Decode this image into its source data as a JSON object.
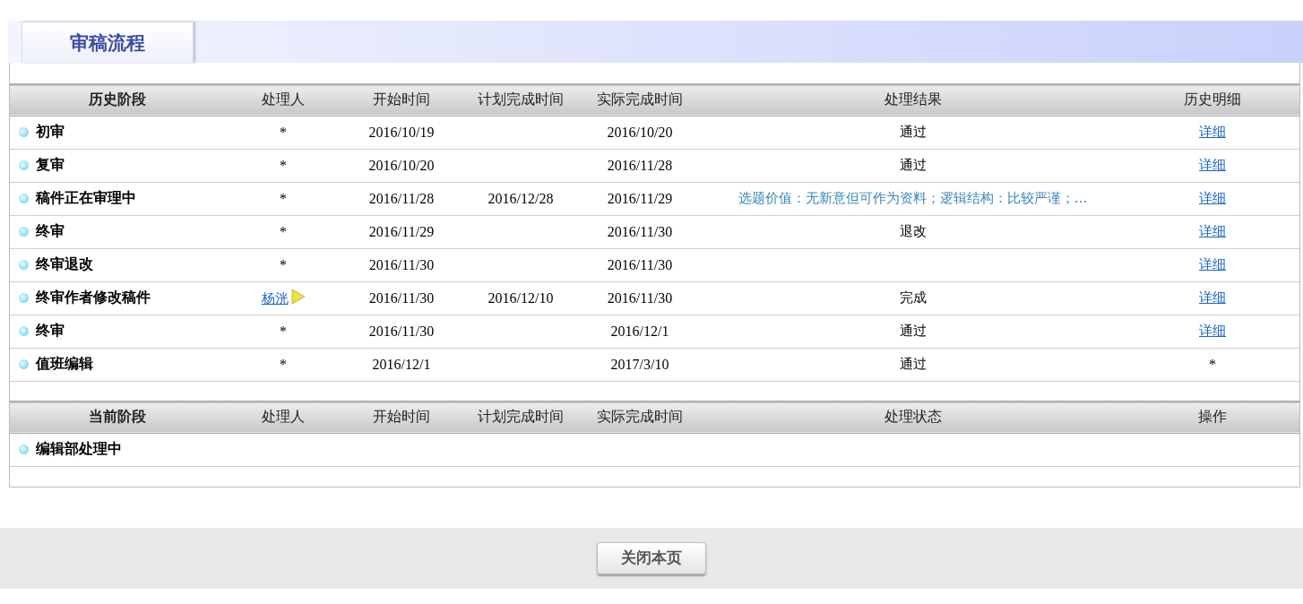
{
  "title_tab": "审稿流程",
  "history": {
    "columns": [
      "历史阶段",
      "处理人",
      "开始时间",
      "计划完成时间",
      "实际完成时间",
      "处理结果",
      "历史明细"
    ],
    "rows": [
      {
        "stage": "初审",
        "handler": {
          "kind": "text",
          "text": "*"
        },
        "start": "2016/10/19",
        "actual": "2016/10/20",
        "result": {
          "kind": "text",
          "text": "通过"
        },
        "detail": {
          "kind": "link",
          "text": "详细"
        }
      },
      {
        "stage": "复审",
        "handler": {
          "kind": "text",
          "text": "*"
        },
        "start": "2016/10/20",
        "actual": "2016/11/28",
        "result": {
          "kind": "text",
          "text": "通过"
        },
        "detail": {
          "kind": "link",
          "text": "详细"
        }
      },
      {
        "stage": "稿件正在审理中",
        "handler": {
          "kind": "text",
          "text": "*"
        },
        "start": "2016/11/28",
        "planned": "2016/12/28",
        "actual": "2016/11/29",
        "result": {
          "kind": "summary",
          "text": "选题价值：无新意但可作为资料；逻辑结构：比较严谨；..."
        },
        "detail": {
          "kind": "link",
          "text": "详细"
        }
      },
      {
        "stage": "终审",
        "handler": {
          "kind": "text",
          "text": "*"
        },
        "start": "2016/11/29",
        "actual": "2016/11/30",
        "result": {
          "kind": "text",
          "text": "退改"
        },
        "detail": {
          "kind": "link",
          "text": "详细"
        }
      },
      {
        "stage": "终审退改",
        "handler": {
          "kind": "text",
          "text": "*"
        },
        "start": "2016/11/30",
        "actual": "2016/11/30",
        "detail": {
          "kind": "link",
          "text": "详细"
        }
      },
      {
        "stage": "终审作者修改稿件",
        "handler": {
          "kind": "link",
          "text": "杨洸"
        },
        "start": "2016/11/30",
        "planned": "2016/12/10",
        "actual": "2016/11/30",
        "result": {
          "kind": "text",
          "text": "完成"
        },
        "detail": {
          "kind": "link",
          "text": "详细"
        }
      },
      {
        "stage": "终审",
        "handler": {
          "kind": "text",
          "text": "*"
        },
        "start": "2016/11/30",
        "actual": "2016/12/1",
        "result": {
          "kind": "text",
          "text": "通过"
        },
        "detail": {
          "kind": "link",
          "text": "详细"
        }
      },
      {
        "stage": "值班编辑",
        "handler": {
          "kind": "text",
          "text": "*"
        },
        "start": "2016/12/1",
        "actual": "2017/3/10",
        "result": {
          "kind": "text",
          "text": "通过"
        },
        "detail": {
          "kind": "text",
          "text": "*"
        }
      }
    ]
  },
  "current": {
    "columns": [
      "当前阶段",
      "处理人",
      "开始时间",
      "计划完成时间",
      "实际完成时间",
      "处理状态",
      "操作"
    ],
    "rows": [
      {
        "stage": "编辑部处理中"
      }
    ]
  },
  "close_button": "关闭本页"
}
